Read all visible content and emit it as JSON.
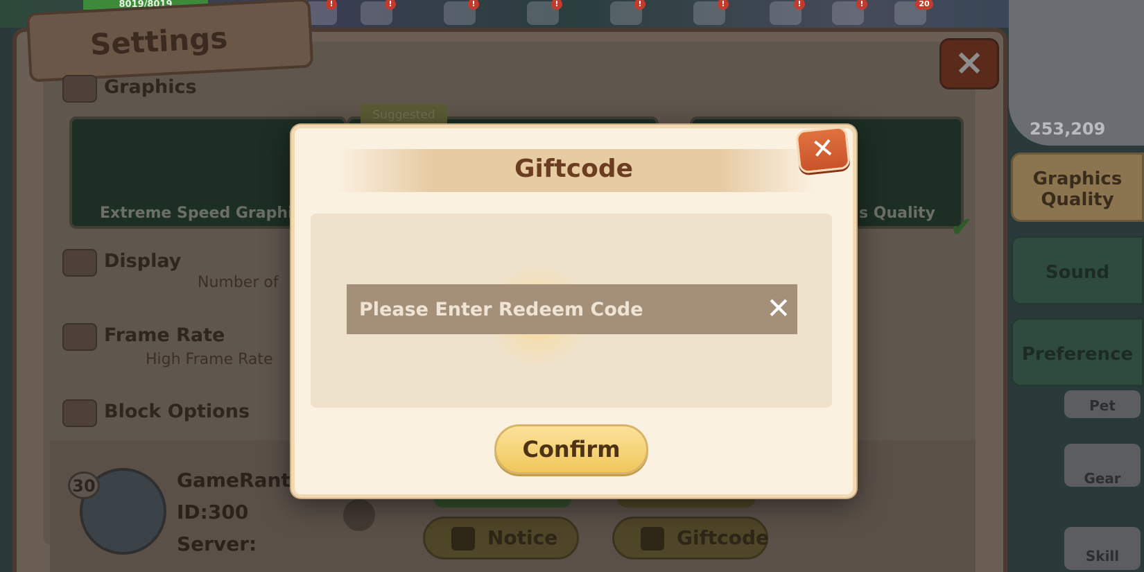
{
  "hud": {
    "hp_text": "8019/8019",
    "alerts": [
      "!",
      "!",
      "!",
      "!",
      "!",
      "!",
      "!",
      "!",
      "20"
    ]
  },
  "settings": {
    "title": "Settings",
    "close_label": "×",
    "sections": [
      {
        "label": "Graphics",
        "sub": ""
      },
      {
        "label": "Display",
        "sub": "Number of"
      },
      {
        "label": "Frame Rate",
        "sub": "High Frame Rate"
      },
      {
        "label": "Block Options",
        "sub": ""
      }
    ],
    "graphics_cards": [
      {
        "label": "Extreme Speed Graphi"
      },
      {
        "label": ""
      },
      {
        "label": "s Quality"
      }
    ],
    "suggested_tag": "Suggested",
    "check_mark": "✔"
  },
  "profile": {
    "level": "30",
    "name": "GameRant",
    "id": "ID:300",
    "server": "Server:"
  },
  "bottom_buttons": [
    {
      "label": "Notice",
      "icon": "notice-icon"
    },
    {
      "label": "Giftcode",
      "icon": "giftcode-icon"
    }
  ],
  "minimap": {
    "coords": "253,209"
  },
  "side_tabs": [
    {
      "label": "Graphics Quality",
      "state": "active"
    },
    {
      "label": "Sound",
      "state": "inactive"
    },
    {
      "label": "Preference",
      "state": "inactive"
    }
  ],
  "side_small": [
    {
      "label": "Pet"
    },
    {
      "label": "Gear"
    },
    {
      "label": "Skill"
    }
  ],
  "modal": {
    "title": "Giftcode",
    "close_label": "✕",
    "input_placeholder": "Please Enter Redeem Code",
    "input_value": "",
    "clear_label": "✕",
    "confirm_label": "Confirm"
  },
  "colors": {
    "modal_bg": "#fbf1e1",
    "title_text": "#6b3e22",
    "confirm_bg": "#f0c75c",
    "close_bg": "#d9612f",
    "input_bg": "#a48f79"
  }
}
